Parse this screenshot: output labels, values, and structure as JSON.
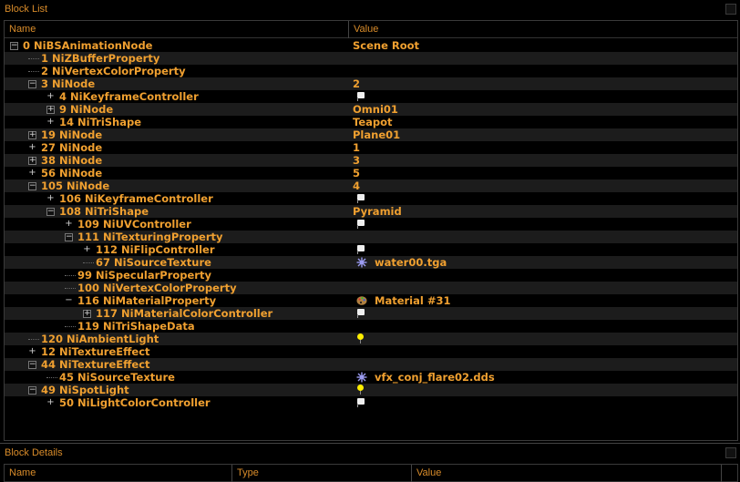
{
  "block_list": {
    "title": "Block List",
    "columns": {
      "name": "Name",
      "value": "Value"
    },
    "rows": [
      {
        "depth": 0,
        "ctrl": "minus",
        "label": "0 NiBSAnimationNode",
        "value": "Scene Root",
        "icon": ""
      },
      {
        "depth": 1,
        "ctrl": "dots",
        "label": "1 NiZBufferProperty",
        "value": "",
        "icon": ""
      },
      {
        "depth": 1,
        "ctrl": "dots",
        "label": "2 NiVertexColorProperty",
        "value": "",
        "icon": ""
      },
      {
        "depth": 1,
        "ctrl": "minus",
        "label": "3 NiNode",
        "value": "2",
        "icon": ""
      },
      {
        "depth": 2,
        "ctrl": "plus",
        "label": "4 NiKeyframeController",
        "value": "",
        "icon": "flag"
      },
      {
        "depth": 2,
        "ctrl": "plusbox",
        "label": "9 NiNode",
        "value": "Omni01",
        "icon": ""
      },
      {
        "depth": 2,
        "ctrl": "plus",
        "label": "14 NiTriShape",
        "value": "Teapot",
        "icon": ""
      },
      {
        "depth": 1,
        "ctrl": "plusbox",
        "label": "19 NiNode",
        "value": "Plane01",
        "icon": ""
      },
      {
        "depth": 1,
        "ctrl": "plus",
        "label": "27 NiNode",
        "value": "1",
        "icon": ""
      },
      {
        "depth": 1,
        "ctrl": "plusbox",
        "label": "38 NiNode",
        "value": "3",
        "icon": ""
      },
      {
        "depth": 1,
        "ctrl": "plus",
        "label": "56 NiNode",
        "value": "5",
        "icon": ""
      },
      {
        "depth": 1,
        "ctrl": "minus",
        "label": "105 NiNode",
        "value": "4",
        "icon": ""
      },
      {
        "depth": 2,
        "ctrl": "plus",
        "label": "106 NiKeyframeController",
        "value": "",
        "icon": "flag"
      },
      {
        "depth": 2,
        "ctrl": "minus",
        "label": "108 NiTriShape",
        "value": "Pyramid",
        "icon": ""
      },
      {
        "depth": 3,
        "ctrl": "plus",
        "label": "109 NiUVController",
        "value": "",
        "icon": "flag"
      },
      {
        "depth": 3,
        "ctrl": "minus",
        "label": "111 NiTexturingProperty",
        "value": "",
        "icon": ""
      },
      {
        "depth": 4,
        "ctrl": "plus",
        "label": "112 NiFlipController",
        "value": "",
        "icon": "flag"
      },
      {
        "depth": 4,
        "ctrl": "dots",
        "label": "67 NiSourceTexture",
        "value": "water00.tga",
        "icon": "texture"
      },
      {
        "depth": 3,
        "ctrl": "dots",
        "label": "99 NiSpecularProperty",
        "value": "",
        "icon": ""
      },
      {
        "depth": 3,
        "ctrl": "dots",
        "label": "100 NiVertexColorProperty",
        "value": "",
        "icon": ""
      },
      {
        "depth": 3,
        "ctrl": "minus-plain",
        "label": "116 NiMaterialProperty",
        "value": "Material #31",
        "icon": "palette"
      },
      {
        "depth": 4,
        "ctrl": "plusbox",
        "label": "117 NiMaterialColorController",
        "value": "",
        "icon": "flag"
      },
      {
        "depth": 3,
        "ctrl": "dots",
        "label": "119 NiTriShapeData",
        "value": "",
        "icon": ""
      },
      {
        "depth": 1,
        "ctrl": "dots",
        "label": "120 NiAmbientLight",
        "value": "",
        "icon": "bulb"
      },
      {
        "depth": 1,
        "ctrl": "plus",
        "label": "12 NiTextureEffect",
        "value": "",
        "icon": ""
      },
      {
        "depth": 1,
        "ctrl": "minus",
        "label": "44 NiTextureEffect",
        "value": "",
        "icon": ""
      },
      {
        "depth": 2,
        "ctrl": "dots",
        "label": "45 NiSourceTexture",
        "value": "vfx_conj_flare02.dds",
        "icon": "texture"
      },
      {
        "depth": 1,
        "ctrl": "minus",
        "label": "49 NiSpotLight",
        "value": "",
        "icon": "bulb"
      },
      {
        "depth": 2,
        "ctrl": "plus",
        "label": "50 NiLightColorController",
        "value": "",
        "icon": "flag"
      }
    ]
  },
  "block_details": {
    "title": "Block Details",
    "columns": {
      "name": "Name",
      "type": "Type",
      "value": "Value"
    }
  },
  "colors": {
    "text": "#f0a030",
    "background": "#000000",
    "alt_row": "#1c1c1c"
  }
}
